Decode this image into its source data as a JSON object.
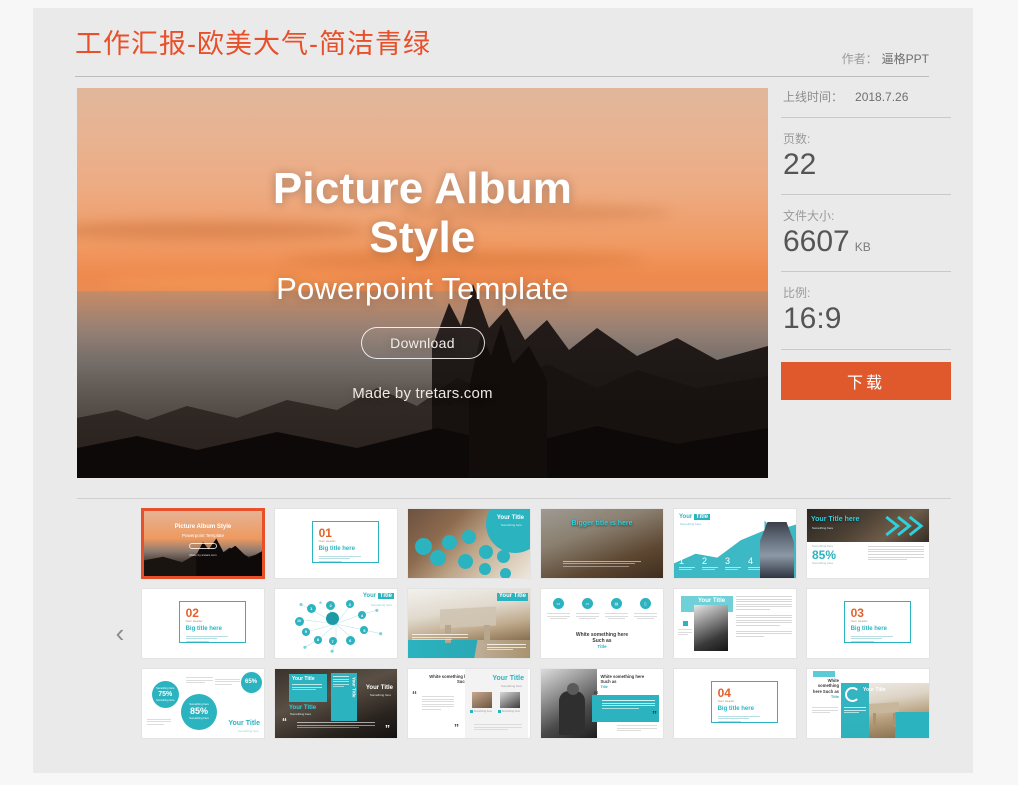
{
  "header": {
    "title": "工作汇报-欧美大气-简洁青绿",
    "author_label": "作者：",
    "author_name": "逼格PPT"
  },
  "sidebar": {
    "upload_time_label": "上线时间：",
    "upload_time_value": "2018.7.26",
    "pages_label": "页数:",
    "pages_value": "22",
    "filesize_label": "文件大小:",
    "filesize_value": "6607",
    "filesize_unit": "KB",
    "ratio_label": "比例:",
    "ratio_value": "16:9",
    "download_button": "下载",
    "download_button_color": "#e0592c"
  },
  "preview": {
    "title_line1": "Picture Album",
    "title_line2": "Style",
    "subtitle": "Powerpoint Template",
    "button_label": "Download",
    "credit": "Made by tretars.com"
  },
  "carousel": {
    "prev_label": "‹",
    "next_label": "›",
    "accent_teal": "#2bb3bf",
    "accent_orange": "#e2622c",
    "selected_index": 0,
    "thumbs": [
      {
        "id": "thumb-1",
        "type": "cover",
        "title": "Picture Album Style",
        "subtitle": "Powerpoint Template",
        "credit": "Made by tretars.com",
        "selected": true
      },
      {
        "id": "thumb-2",
        "type": "number-card",
        "number": "01",
        "kicker": "Num Header",
        "title": "Big title here"
      },
      {
        "id": "thumb-3",
        "type": "bubble-photo",
        "title": "Your Title",
        "subtitle": "Something here"
      },
      {
        "id": "thumb-4",
        "type": "photo-title",
        "title": "Bigger title is here"
      },
      {
        "id": "thumb-5",
        "type": "chart-steps",
        "title": "Your Title",
        "subtitle": "Something here",
        "steps": [
          "1",
          "2",
          "3",
          "4"
        ]
      },
      {
        "id": "thumb-6",
        "type": "arrow-stat",
        "title": "Your Title here",
        "stat": "85%",
        "stat_caption": "Something here"
      },
      {
        "id": "thumb-7",
        "type": "number-card",
        "number": "02",
        "kicker": "Num Header",
        "title": "Big title here"
      },
      {
        "id": "thumb-8",
        "type": "network",
        "title": "Your Title",
        "subtitle": "Something here",
        "nodes": [
          "1",
          "2",
          "3",
          "4",
          "5",
          "6",
          "7",
          "8",
          "9",
          "10"
        ]
      },
      {
        "id": "thumb-9",
        "type": "interior",
        "title": "Your Title"
      },
      {
        "id": "thumb-10",
        "type": "icon-row",
        "headline": "White something here",
        "headline2": "Such as",
        "headline3": "Title",
        "icons": [
          "monitor-icon",
          "laptop-icon",
          "card-icon",
          "phone-icon"
        ]
      },
      {
        "id": "thumb-11",
        "type": "portrait-text",
        "title": "Your Title",
        "subtitle": "Something here"
      },
      {
        "id": "thumb-12",
        "type": "number-card",
        "number": "03",
        "kicker": "Num Header",
        "title": "Big title here"
      },
      {
        "id": "thumb-13",
        "type": "percent-circles",
        "title": "Your Title",
        "percents": [
          "75%",
          "85%",
          "65%"
        ]
      },
      {
        "id": "thumb-14",
        "type": "quote-city",
        "title": "Your Title"
      },
      {
        "id": "thumb-15",
        "type": "quote-team",
        "headline": "White something here",
        "headline2": "Such as",
        "headline3": "Title",
        "title": "Your Title"
      },
      {
        "id": "thumb-16",
        "type": "quote-bw",
        "headline": "White something here",
        "headline2": "Such as",
        "headline3": "Title"
      },
      {
        "id": "thumb-17",
        "type": "number-card",
        "number": "04",
        "kicker": "Num Header",
        "title": "Big title here"
      },
      {
        "id": "thumb-18",
        "type": "donut-room",
        "headline": "White something here Such as",
        "headline3": "Title",
        "title": "Your Title"
      }
    ]
  }
}
